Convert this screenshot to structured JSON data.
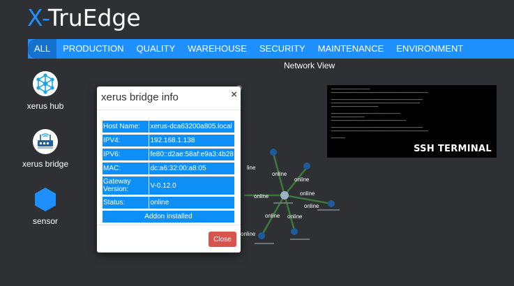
{
  "app": {
    "logo_x": "X-",
    "logo_rest": "TruEdge"
  },
  "nav": [
    {
      "label": "ALL",
      "active": true
    },
    {
      "label": "PRODUCTION"
    },
    {
      "label": "QUALITY"
    },
    {
      "label": "WAREHOUSE"
    },
    {
      "label": "SECURITY"
    },
    {
      "label": "MAINTENANCE"
    },
    {
      "label": "ENVIRONMENT"
    }
  ],
  "network_view": {
    "title": "Network View",
    "edge_labels": [
      "line",
      "online",
      "online",
      "online",
      "online",
      "online",
      "online",
      "online",
      "online"
    ]
  },
  "sidebar": {
    "items": [
      {
        "label": "xerus hub",
        "icon": "hub-icon"
      },
      {
        "label": "xerus bridge",
        "icon": "bridge-icon"
      },
      {
        "label": "sensor",
        "icon": "hexagon-icon"
      }
    ]
  },
  "ssh": {
    "label": "SSH TERMINAL"
  },
  "modal": {
    "title": "xerus bridge info",
    "close_x": "×",
    "rows": [
      {
        "key": "Host Name:",
        "value": "xerus-dca63200a805.local"
      },
      {
        "key": "IPV4:",
        "value": "192.168.1.138"
      },
      {
        "key": "IPV6:",
        "value": "fe80::d2ae:58af:e9a3:4b28"
      },
      {
        "key": "MAC:",
        "value": "dc:a6:32:00:a8:05"
      },
      {
        "key": "Gateway Version:",
        "value": "V-0.12.0"
      },
      {
        "key": "Status:",
        "value": "online"
      }
    ],
    "addon": "Addon installed",
    "close_button": "Close"
  },
  "colors": {
    "brand_blue": "#1e90ff",
    "table_blue": "#0e8ff5",
    "close_red": "#d9534f",
    "background": "#2e3033"
  }
}
